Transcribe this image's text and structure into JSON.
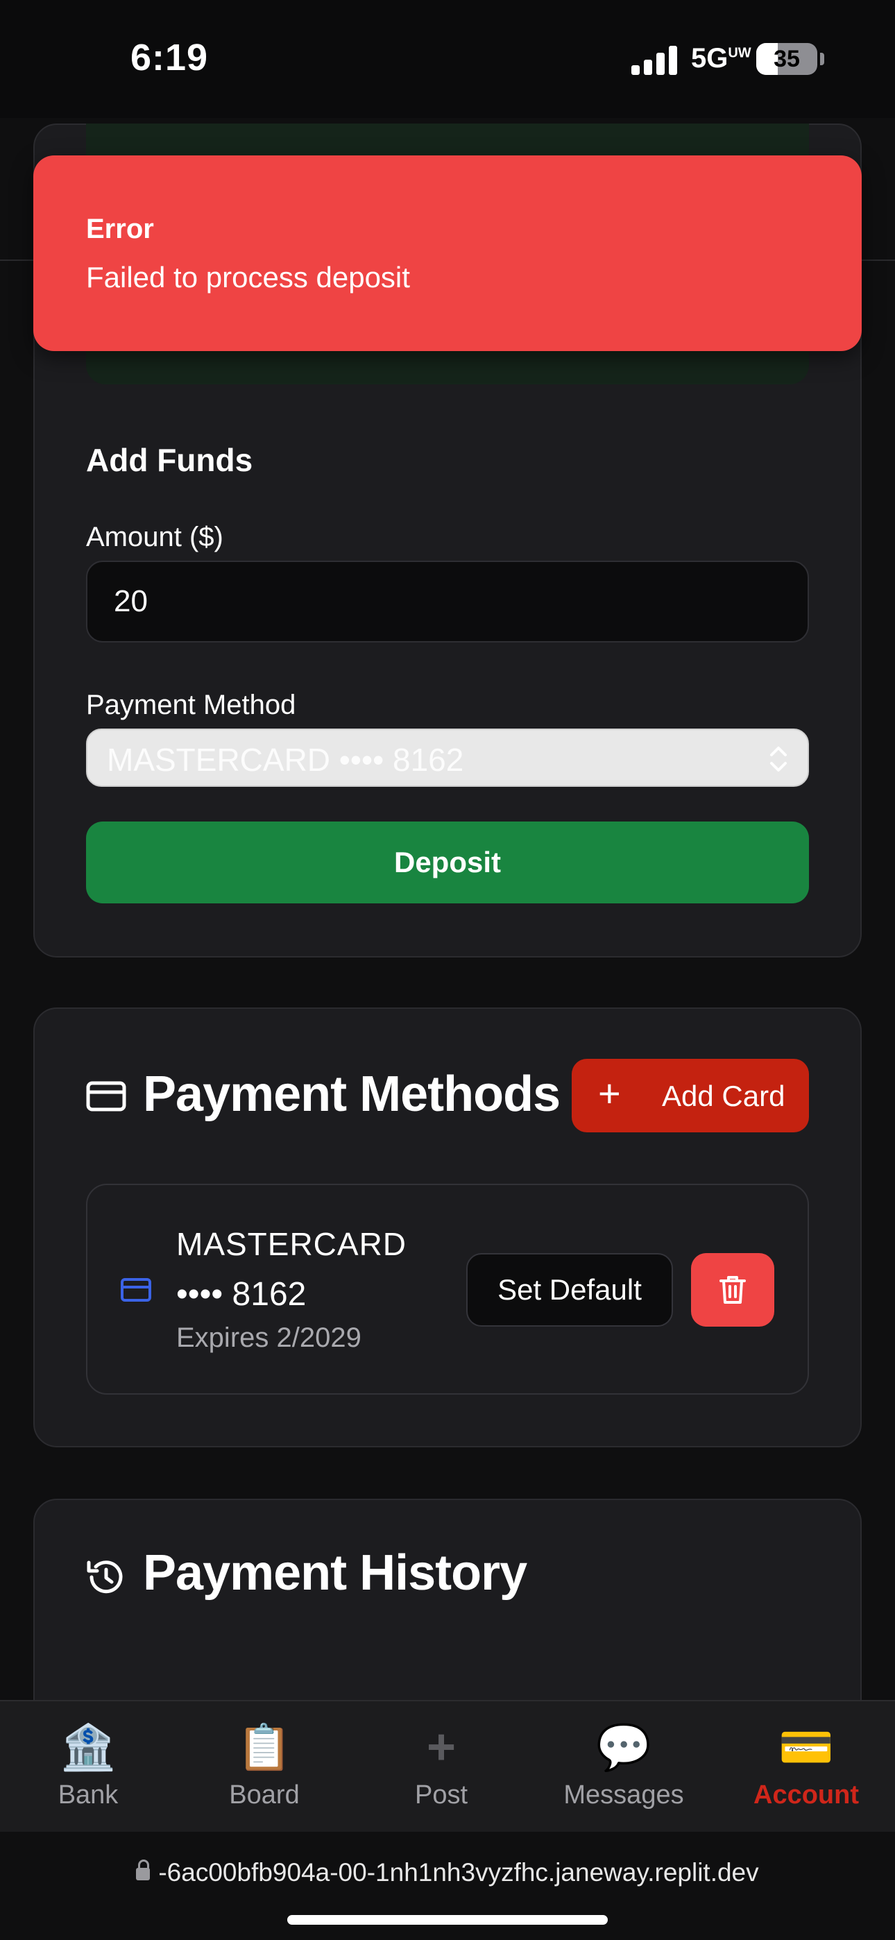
{
  "status_bar": {
    "time": "6:19",
    "network": "5G",
    "network_sup": "UW",
    "battery": "35"
  },
  "toast": {
    "title": "Error",
    "message": "Failed to process deposit"
  },
  "add_funds": {
    "title": "Add Funds",
    "amount_label": "Amount ($)",
    "amount_value": "20",
    "payment_method_label": "Payment Method",
    "payment_method_selected": "MASTERCARD •••• 8162",
    "deposit_label": "Deposit"
  },
  "payment_methods": {
    "title": "Payment Methods",
    "add_card_label": "Add Card",
    "cards": [
      {
        "brand": "MASTERCARD",
        "number": "•••• 8162",
        "expires": "Expires 2/2029",
        "set_default_label": "Set Default"
      }
    ]
  },
  "payment_history": {
    "title": "Payment History"
  },
  "bottom_nav": {
    "items": [
      {
        "label": "Bank",
        "icon": "bank-icon"
      },
      {
        "label": "Board",
        "icon": "clipboard-icon"
      },
      {
        "label": "Post",
        "icon": "plus-icon"
      },
      {
        "label": "Messages",
        "icon": "speech-bubble-icon"
      },
      {
        "label": "Account",
        "icon": "credit-card-icon",
        "active": true
      }
    ]
  },
  "browser": {
    "url": "-6ac00bfb904a-00-1nh1nh3vyzfhc.janeway.replit.dev"
  },
  "colors": {
    "error": "#ef4444",
    "deposit": "#198540",
    "add_card": "#c42210",
    "active_nav": "#d0261a"
  }
}
